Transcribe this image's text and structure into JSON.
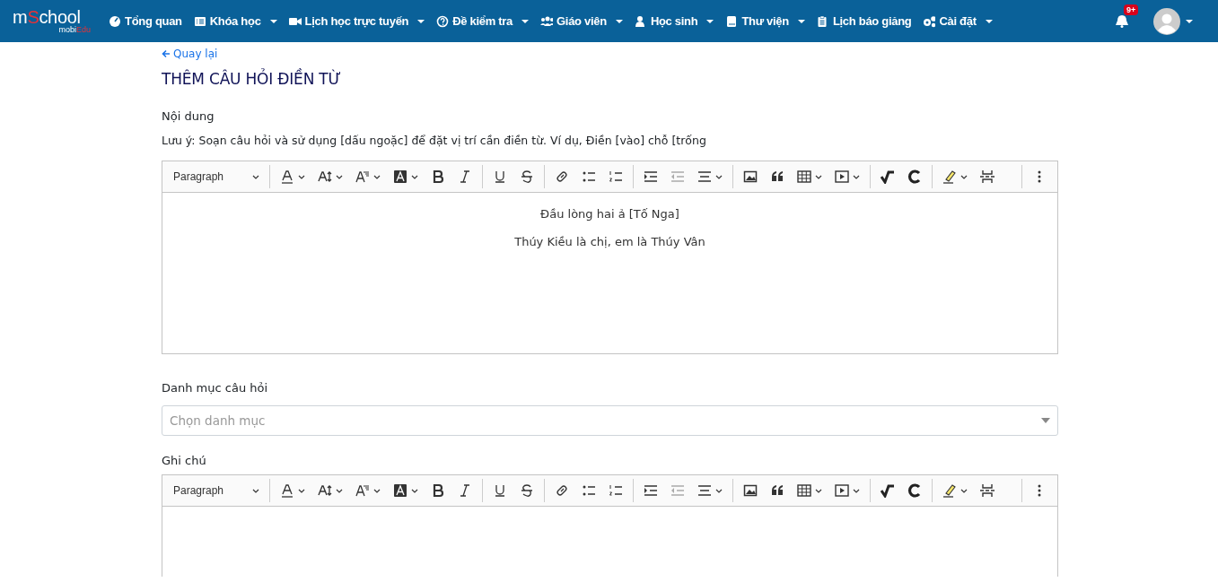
{
  "logo": {
    "lead": "m",
    "accent": "S",
    "tail": "chool",
    "sub_lead": "mobi",
    "sub_accent": "Edu"
  },
  "nav": [
    {
      "label": "Tổng quan",
      "dropdown": false
    },
    {
      "label": "Khóa học",
      "dropdown": true
    },
    {
      "label": "Lịch học trực tuyến",
      "dropdown": true
    },
    {
      "label": "Đề kiểm tra",
      "dropdown": true
    },
    {
      "label": "Giáo viên",
      "dropdown": true
    },
    {
      "label": "Học sinh",
      "dropdown": true
    },
    {
      "label": "Thư viện",
      "dropdown": true
    },
    {
      "label": "Lịch báo giảng",
      "dropdown": false
    },
    {
      "label": "Cài đặt",
      "dropdown": true
    }
  ],
  "notifications": {
    "badge": "9+"
  },
  "back_link": "Quay lại",
  "title": "THÊM CÂU HỎI ĐIỀN TỪ",
  "content_label": "Nội dung",
  "note": "Lưu ý: Soạn câu hỏi và sử dụng [dấu ngoặc] để đặt vị trí cần điền từ. Ví dụ, Điền [vào] chỗ [trống",
  "content_editor": {
    "heading": "Paragraph",
    "paragraphs": [
      "Đầu lòng hai ả [Tố Nga]",
      "Thúy Kiều là chị, em là Thúy Vân"
    ]
  },
  "category_label": "Danh mục câu hỏi",
  "category_select": {
    "placeholder": "Chọn danh mục"
  },
  "notes_label": "Ghi chú",
  "notes_editor": {
    "heading": "Paragraph"
  }
}
